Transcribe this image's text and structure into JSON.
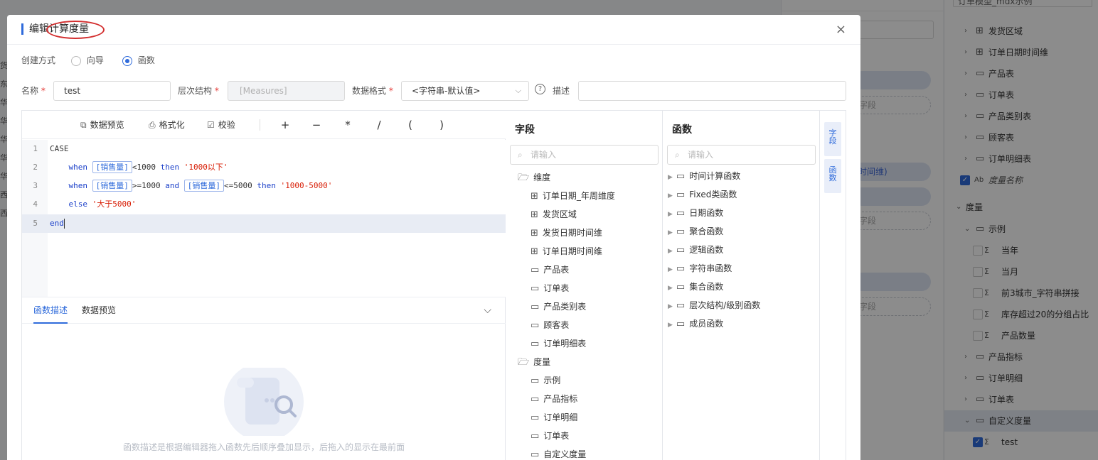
{
  "modal": {
    "title": "编辑计算度量",
    "close": "×"
  },
  "method": {
    "label": "创建方式",
    "options": [
      "向导",
      "函数"
    ],
    "selected": "函数"
  },
  "form": {
    "name_label": "名称",
    "name_value": "test",
    "hierarchy_label": "层次结构",
    "hierarchy_value": "[Measures]",
    "format_label": "数据格式",
    "format_value": "<字符串-默认值>",
    "desc_label": "描述",
    "desc_value": "",
    "required_mark": "*"
  },
  "toolbar": {
    "preview": "数据预览",
    "format": "格式化",
    "validate": "校验",
    "operators": [
      "+",
      "−",
      "*",
      "/",
      "(",
      ")"
    ]
  },
  "code": {
    "line_numbers": [
      "1",
      "2",
      "3",
      "4",
      "5"
    ],
    "line1": "CASE",
    "when": "when",
    "then": "then",
    "and": "and",
    "else": "else",
    "end": "end",
    "field": "[销售量]",
    "op_lt1000": "<1000",
    "op_ge1000": ">=1000",
    "op_le5000": "<=5000",
    "str1": "'1000以下'",
    "str2": "'1000-5000'",
    "str3": "'大于5000'"
  },
  "desc": {
    "tabs": [
      "函数描述",
      "数据预览"
    ],
    "active_tab": "函数描述",
    "empty_text": "函数描述是根据编辑器拖入函数先后顺序叠加显示，后拖入的显示在最前面"
  },
  "fields_panel": {
    "title": "字段",
    "search_placeholder": "请输入",
    "dim_group": "维度",
    "dims": [
      "订单日期_年周维度",
      "发货区域",
      "发货日期时间维",
      "订单日期时间维",
      "产品表",
      "订单表",
      "产品类别表",
      "顾客表",
      "订单明细表"
    ],
    "measure_group": "度量",
    "measures": [
      "示例",
      "产品指标",
      "订单明细",
      "订单表",
      "自定义度量"
    ]
  },
  "functions_panel": {
    "title": "函数",
    "search_placeholder": "请输入",
    "groups": [
      "时间计算函数",
      "Fixed类函数",
      "日期函数",
      "聚合函数",
      "逻辑函数",
      "字符串函数",
      "集合函数",
      "层次结构/级别函数",
      "成员函数"
    ]
  },
  "side_tabs": [
    "字段",
    "函数"
  ],
  "background": {
    "left_strip": [
      "货",
      "东",
      "华",
      "华",
      "华",
      "华",
      "华",
      "西",
      "西"
    ],
    "top_box": "订单模型_mdx示例",
    "mid_pills": [
      "时间维)"
    ],
    "mid_dashes": [
      "字段",
      "字段",
      "字段"
    ],
    "tree": {
      "dims": [
        "发货区域",
        "订单日期时间维",
        "产品表",
        "订单表",
        "产品类别表",
        "顾客表",
        "订单明细表"
      ],
      "measure_name": "度量名称",
      "measure_group": "度量",
      "example_folder": "示例",
      "example_items": [
        "当年",
        "当月",
        "前3城市_字符串拼接",
        "库存超过20的分组占比",
        "产品数量"
      ],
      "folders": [
        "产品指标",
        "订单明细",
        "订单表"
      ],
      "custom_folder": "自定义度量",
      "custom_item": "test"
    }
  }
}
